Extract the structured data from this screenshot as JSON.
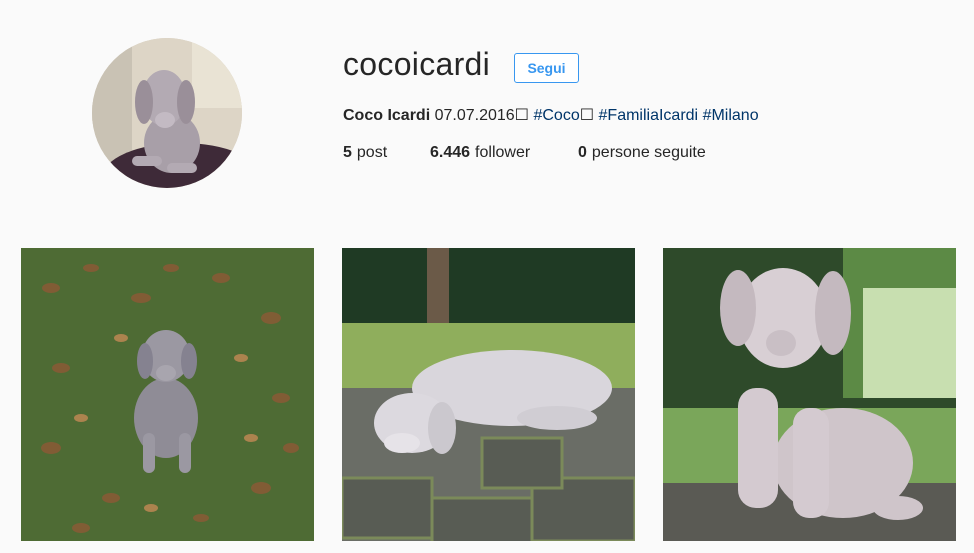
{
  "profile": {
    "username": "cocoicardi",
    "follow_label": "Segui",
    "display_name": "Coco Icardi",
    "bio_date": "07.07.2016",
    "bio_box": "☐",
    "hashtags": [
      "#Coco",
      "#FamiliaIcardi",
      "#Milano"
    ],
    "stats": {
      "posts_count": "5",
      "posts_label": "post",
      "followers_count": "6.446",
      "followers_label": "follower",
      "following_count": "0",
      "following_label": "persone seguite"
    }
  },
  "posts": [
    {
      "subject": "puppy-on-leaves-photo"
    },
    {
      "subject": "puppy-lying-on-pavement-photo"
    },
    {
      "subject": "puppy-sitting-photo"
    }
  ],
  "colors": {
    "background": "#fafafa",
    "accent": "#3897f0",
    "hashtag": "#003569",
    "text": "#262626"
  }
}
